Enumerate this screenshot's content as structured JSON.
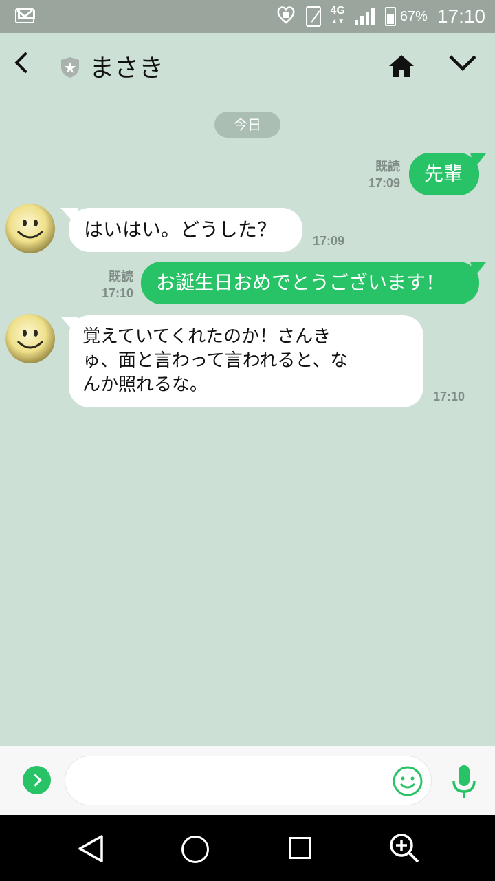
{
  "status_bar": {
    "time": "17:10",
    "battery": "67%",
    "network": "4G",
    "icons": [
      "gmail-icon",
      "heart-lock-icon",
      "phone-vibrate-icon",
      "signal-icon",
      "battery-icon"
    ]
  },
  "header": {
    "title": "まさき",
    "icons": [
      "back-arrow-icon",
      "shield-star-icon",
      "home-icon",
      "chevron-down-icon"
    ]
  },
  "chat": {
    "date_label": "今日",
    "messages": [
      {
        "direction": "out",
        "text": "先輩",
        "read": "既読",
        "time": "17:09"
      },
      {
        "direction": "in",
        "text": "はいはい。どうした？",
        "time": "17:09"
      },
      {
        "direction": "out",
        "text": "お誕生日おめでとうございます！",
        "read": "既読",
        "time": "17:10"
      },
      {
        "direction": "in",
        "lines": [
          "覚えていてくれたのか！さんき",
          "ゅ、面と言わって言われると、な",
          "んか照れるな。"
        ],
        "time": "17:10"
      }
    ]
  },
  "input_bar": {
    "value": "",
    "placeholder": "",
    "icons": [
      "expand-icon",
      "emoji-icon",
      "microphone-icon"
    ]
  },
  "nav_bar": {
    "icons": [
      "nav-back-icon",
      "nav-home-icon",
      "nav-recents-icon",
      "magnifier-icon"
    ]
  },
  "colors": {
    "background": "#cde0d6",
    "accent_green": "#28c267",
    "status_bar": "#9aa59e",
    "date_pill": "#abbeb4"
  }
}
